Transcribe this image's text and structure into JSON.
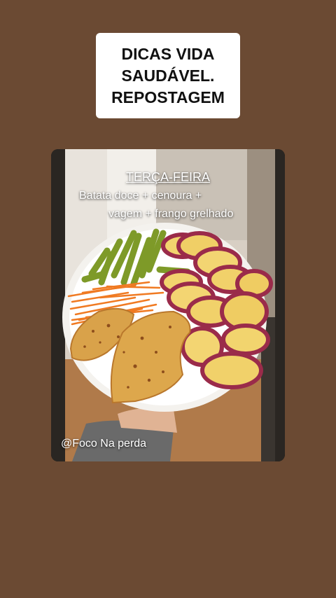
{
  "header": {
    "lines": [
      "DICAS VIDA",
      "SAUDÁVEL.",
      "REPOSTAGEM"
    ]
  },
  "post": {
    "day": "TERÇA-FEIRA",
    "menu_line_1": "Batata doce + cenoura +",
    "menu_line_2": "vagem + frango grelhado",
    "watermark": "@Foco Na perda"
  },
  "colors": {
    "background": "#6b4a33",
    "card": "#ffffff"
  }
}
